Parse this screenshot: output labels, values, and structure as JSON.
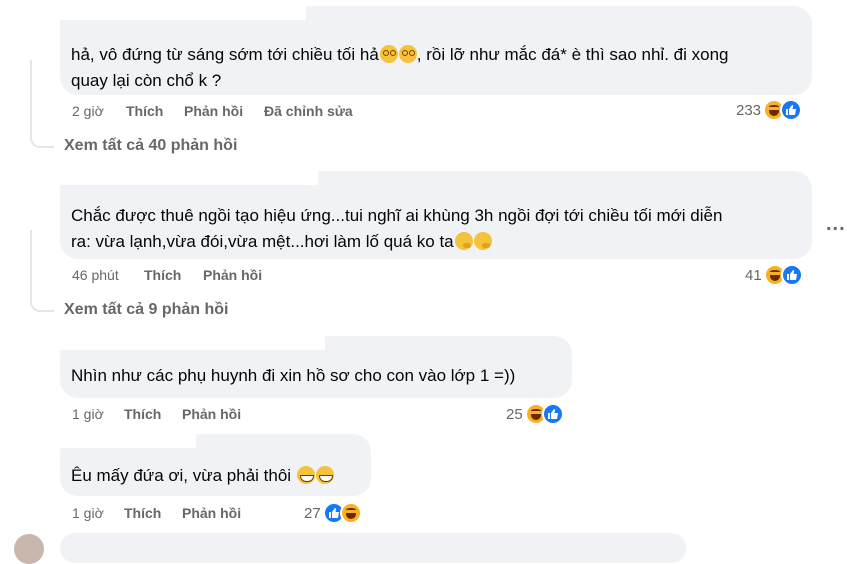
{
  "comments": [
    {
      "lines": [
        "hả, vô đứng từ sáng sớm tới chiều tối hả",
        ", rồi lỡ như mắc đá* è thì sao nhỉ. đi xong",
        "quay lại còn chổ k ?"
      ],
      "inline_emojis": [
        "flushed-face",
        "flushed-face"
      ],
      "time": "2 giờ",
      "like": "Thích",
      "reply": "Phản hồi",
      "edited": "Đã chỉnh sửa",
      "reaction_count": "233",
      "reactions": [
        "haha",
        "like"
      ]
    },
    {
      "lines": [
        "Chắc được thuê ngồi tạo hiệu ứng...tui nghĩ ai khùng 3h ngồi đợi tới chiều tối mới diễn",
        "ra: vừa lạnh,vừa đói,vừa mệt...hơi làm lố quá ko ta"
      ],
      "inline_emojis": [
        "thinking-face",
        "thinking-face"
      ],
      "time": "46 phút",
      "like": "Thích",
      "reply": "Phản hồi",
      "reaction_count": "41",
      "reactions": [
        "haha",
        "like"
      ]
    },
    {
      "lines": [
        "Nhìn như các phụ huynh đi xin hồ sơ cho con vào lớp 1 =))"
      ],
      "time": "1 giờ",
      "like": "Thích",
      "reply": "Phản hồi",
      "reaction_count": "25",
      "reactions": [
        "haha",
        "like"
      ]
    },
    {
      "lines": [
        "Êu mấy đứa ơi, vừa phải thôi"
      ],
      "inline_emojis": [
        "grinning-face",
        "grinning-face"
      ],
      "time": "1 giờ",
      "like": "Thích",
      "reply": "Phản hồi",
      "reaction_count": "27",
      "reactions": [
        "like",
        "haha"
      ]
    }
  ],
  "view_all": [
    "Xem tất cả 40 phản hồi",
    "Xem tất cả 9 phản hồi"
  ],
  "more_menu": "...",
  "colors": {
    "bubble": "#f0f2f5",
    "meta": "#65676b",
    "like_blue": "#1877f2",
    "haha_yellow": "#f7b125"
  }
}
